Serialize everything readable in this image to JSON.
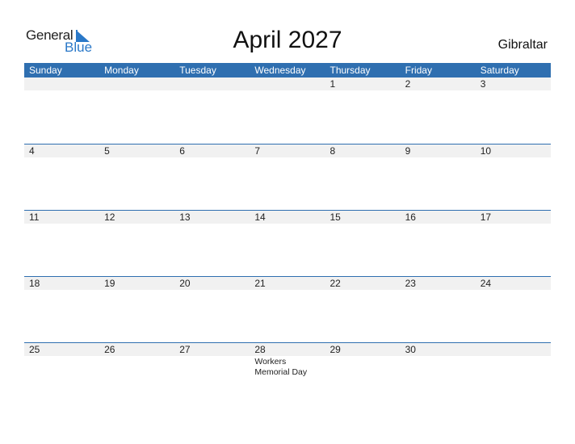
{
  "logo": {
    "word1": "General",
    "word2": "Blue"
  },
  "title": "April 2027",
  "country": "Gibraltar",
  "colors": {
    "header": "#2f6fb0",
    "date_strip": "#f1f1f1",
    "logo_blue": "#2a78c8"
  },
  "weekdays": [
    "Sunday",
    "Monday",
    "Tuesday",
    "Wednesday",
    "Thursday",
    "Friday",
    "Saturday"
  ],
  "weeks": [
    {
      "days": [
        "",
        "",
        "",
        "",
        "1",
        "2",
        "3"
      ],
      "events": [
        "",
        "",
        "",
        "",
        "",
        "",
        ""
      ]
    },
    {
      "days": [
        "4",
        "5",
        "6",
        "7",
        "8",
        "9",
        "10"
      ],
      "events": [
        "",
        "",
        "",
        "",
        "",
        "",
        ""
      ]
    },
    {
      "days": [
        "11",
        "12",
        "13",
        "14",
        "15",
        "16",
        "17"
      ],
      "events": [
        "",
        "",
        "",
        "",
        "",
        "",
        ""
      ]
    },
    {
      "days": [
        "18",
        "19",
        "20",
        "21",
        "22",
        "23",
        "24"
      ],
      "events": [
        "",
        "",
        "",
        "",
        "",
        "",
        ""
      ]
    },
    {
      "days": [
        "25",
        "26",
        "27",
        "28",
        "29",
        "30",
        ""
      ],
      "events": [
        "",
        "",
        "",
        "Workers Memorial Day",
        "",
        "",
        ""
      ]
    }
  ]
}
